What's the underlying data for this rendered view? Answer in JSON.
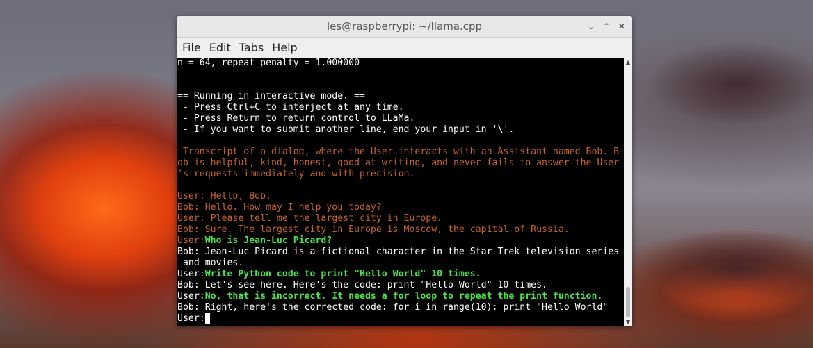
{
  "window": {
    "title": "les@raspberrypi: ~/llama.cpp",
    "buttons": {
      "minimize": "⌄",
      "maximize": "⌃",
      "close": "✕"
    }
  },
  "menu": [
    "File",
    "Edit",
    "Tabs",
    "Help"
  ],
  "terminal": {
    "lines": [
      {
        "segments": [
          {
            "text": "n = 64, repeat_penalty = 1.000000",
            "style": "white"
          }
        ]
      },
      {
        "segments": []
      },
      {
        "segments": []
      },
      {
        "segments": [
          {
            "text": "== Running in interactive mode. ==",
            "style": "white"
          }
        ]
      },
      {
        "segments": [
          {
            "text": " - Press Ctrl+C to interject at any time.",
            "style": "white"
          }
        ]
      },
      {
        "segments": [
          {
            "text": " - Press Return to return control to LLaMa.",
            "style": "white"
          }
        ]
      },
      {
        "segments": [
          {
            "text": " - If you want to submit another line, end your input in '\\'.",
            "style": "white"
          }
        ]
      },
      {
        "segments": []
      },
      {
        "segments": [
          {
            "text": " Transcript of a dialog, where the User interacts with an Assistant named Bob. B",
            "style": "orange"
          }
        ]
      },
      {
        "segments": [
          {
            "text": "ob is helpful, kind, honest, good at writing, and never fails to answer the User",
            "style": "orange"
          }
        ]
      },
      {
        "segments": [
          {
            "text": "'s requests immediately and with precision.",
            "style": "orange"
          }
        ]
      },
      {
        "segments": []
      },
      {
        "segments": [
          {
            "text": "User: Hello, Bob.",
            "style": "orange"
          }
        ]
      },
      {
        "segments": [
          {
            "text": "Bob: Hello. How may I help you today?",
            "style": "orange"
          }
        ]
      },
      {
        "segments": [
          {
            "text": "User: Please tell me the largest city in Europe.",
            "style": "orange"
          }
        ]
      },
      {
        "segments": [
          {
            "text": "Bob: Sure. The largest city in Europe is Moscow, the capital of Russia.",
            "style": "orange"
          }
        ]
      },
      {
        "segments": [
          {
            "text": "User:",
            "style": "orange"
          },
          {
            "text": "Who is Jean-Luc Picard?",
            "style": "green"
          }
        ]
      },
      {
        "segments": [
          {
            "text": "Bob: Jean-Luc Picard is a fictional character in the Star Trek television series",
            "style": "white"
          }
        ]
      },
      {
        "segments": [
          {
            "text": " and movies.",
            "style": "white"
          }
        ]
      },
      {
        "segments": [
          {
            "text": "User:",
            "style": "white"
          },
          {
            "text": "Write Python code to print \"Hello World\" 10 times.",
            "style": "green"
          }
        ]
      },
      {
        "segments": [
          {
            "text": "Bob: Let's see here. Here's the code: print \"Hello World\" 10 times.",
            "style": "white"
          }
        ]
      },
      {
        "segments": [
          {
            "text": "User:",
            "style": "white"
          },
          {
            "text": "No, that is incorrect. It needs a for loop to repeat the print function.",
            "style": "green"
          }
        ]
      },
      {
        "segments": [
          {
            "text": "Bob: Right, here's the corrected code: for i in range(10): print \"Hello World\"",
            "style": "white"
          }
        ]
      },
      {
        "segments": [
          {
            "text": "User:",
            "style": "white"
          }
        ],
        "cursor": true
      }
    ]
  },
  "scrollbar": {
    "up_icon": "▲",
    "down_icon": "▼"
  }
}
